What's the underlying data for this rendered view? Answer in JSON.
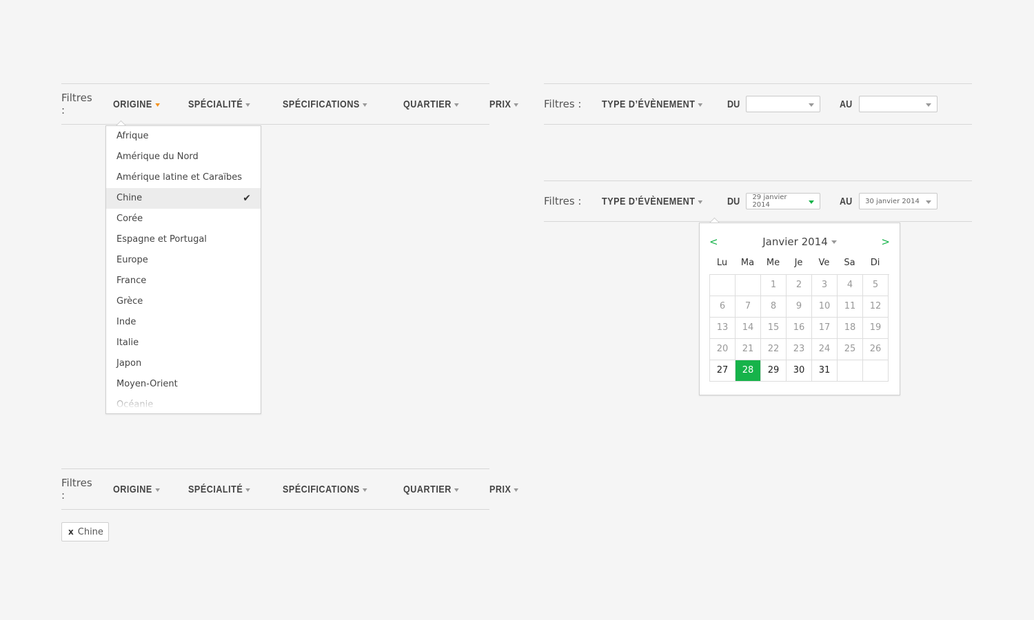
{
  "filters_label": "Filtres :",
  "filter_bar": {
    "items": [
      "Origine",
      "Spécialité",
      "Spécifications",
      "Quartier",
      "Prix"
    ]
  },
  "origin_dropdown": {
    "items": [
      {
        "label": "Afrique"
      },
      {
        "label": "Amérique du Nord"
      },
      {
        "label": "Amérique latine et Caraïbes"
      },
      {
        "label": "Chine",
        "selected": true
      },
      {
        "label": "Corée"
      },
      {
        "label": "Espagne et Portugal"
      },
      {
        "label": "Europe"
      },
      {
        "label": "France"
      },
      {
        "label": "Grèce"
      },
      {
        "label": "Inde"
      },
      {
        "label": "Italie"
      },
      {
        "label": "Japon"
      },
      {
        "label": "Moyen-Orient"
      },
      {
        "label": "Océanie"
      }
    ],
    "check_icon": "check-icon"
  },
  "event_filter": {
    "type_label": "Type d’évènement",
    "from_label": "Du",
    "to_label": "Au"
  },
  "event_filter_filled": {
    "from_value": "29 janvier 2014",
    "to_value": "30 janvier 2014"
  },
  "active_tag": {
    "remove": "x",
    "label": "Chine"
  },
  "calendar": {
    "prev": "<",
    "next": ">",
    "title": "Janvier 2014",
    "weekdays": [
      "Lu",
      "Ma",
      "Me",
      "Je",
      "Ve",
      "Sa",
      "Di"
    ],
    "leading_blanks": 2,
    "days": 31,
    "selected_day": 28,
    "active_days": [
      27,
      28,
      29,
      30,
      31
    ],
    "trailing_blanks": 2
  },
  "colors": {
    "accent_green": "#16b34a",
    "accent_orange": "#f5921e"
  }
}
